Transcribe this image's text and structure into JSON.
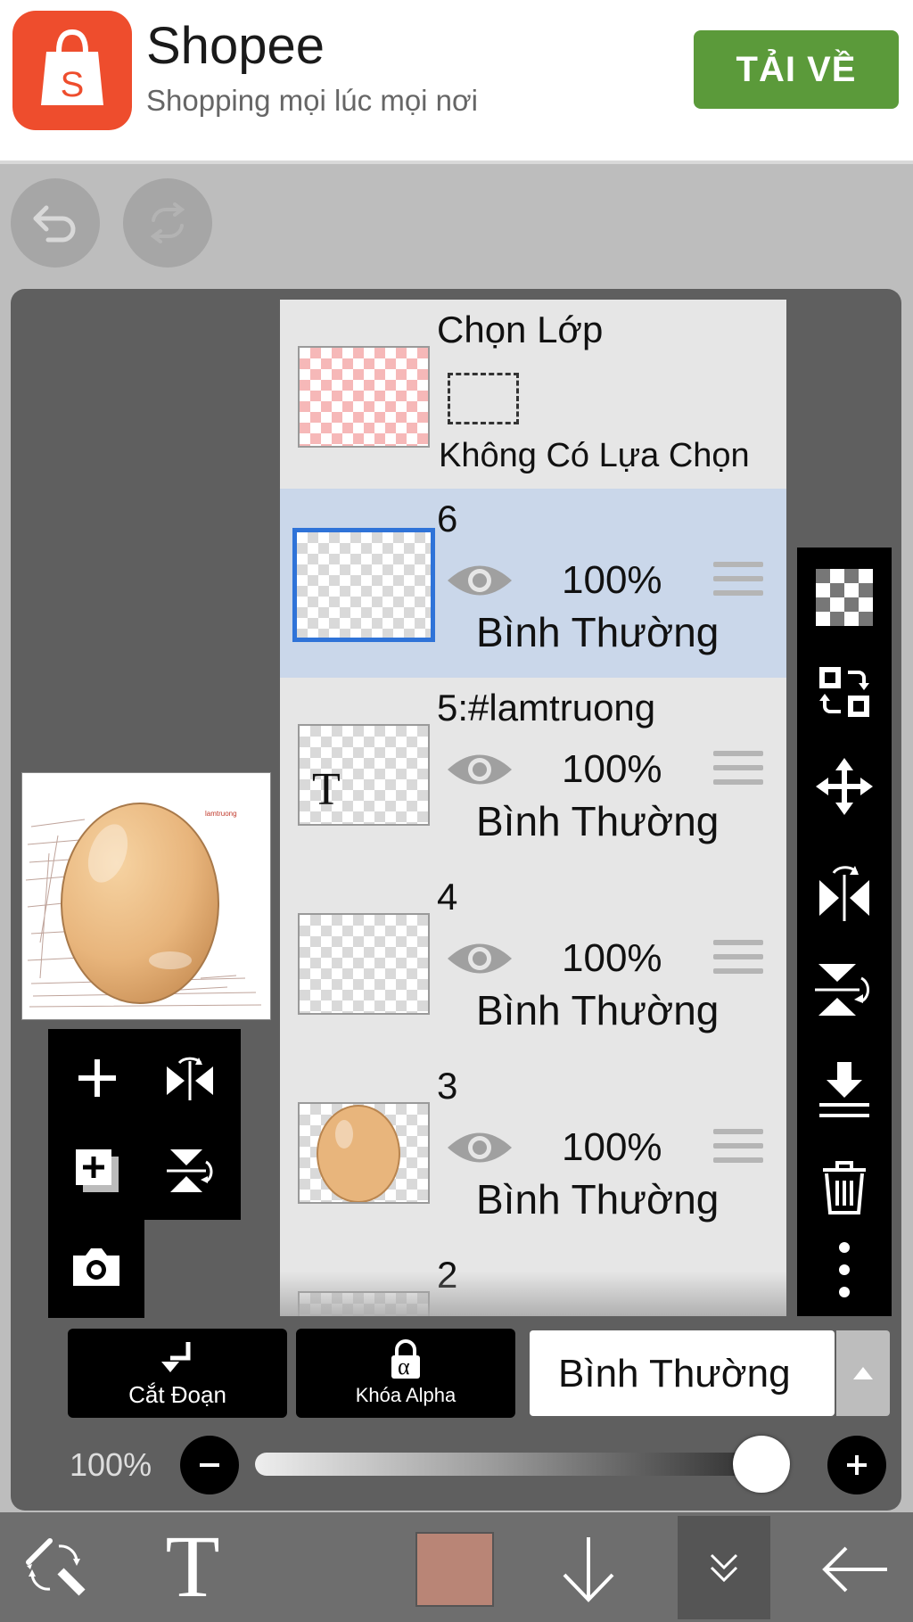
{
  "ad": {
    "app_name": "Shopee",
    "tagline": "Shopping mọi lúc mọi nơi",
    "logo_letter": "S",
    "cta_label": "TẢI VỀ",
    "brand_color": "#ee4d2d",
    "cta_color": "#5b9a3a"
  },
  "top_controls": {
    "undo_icon": "undo-icon",
    "redo_icon": "redo-icon"
  },
  "selection_layer": {
    "title": "Chọn Lớp",
    "status": "Không Có Lựa Chọn"
  },
  "layers": [
    {
      "name": "6",
      "opacity": "100%",
      "blend": "Bình Thường",
      "selected": true
    },
    {
      "name": "5:#lamtruong",
      "opacity": "100%",
      "blend": "Bình Thường",
      "thumb_glyph": "T"
    },
    {
      "name": "4",
      "opacity": "100%",
      "blend": "Bình Thường"
    },
    {
      "name": "3",
      "opacity": "100%",
      "blend": "Bình Thường"
    },
    {
      "name": "2"
    }
  ],
  "preview_caption": "lamtruong",
  "right_tools": [
    "transparency-icon",
    "layer-swap-icon",
    "move-icon",
    "flip-horizontal-icon",
    "flip-vertical-icon",
    "merge-down-icon",
    "trash-icon",
    "more-icon"
  ],
  "left_tools": [
    "add-layer-icon",
    "flip-horizontal-icon",
    "duplicate-layer-icon",
    "flip-vertical-icon",
    "camera-icon"
  ],
  "actions": {
    "clip_label": "Cắt Đoạn",
    "alpha_lock_label": "Khóa Alpha",
    "alpha_symbol": "α",
    "blend_mode": "Bình Thường"
  },
  "opacity": {
    "label": "100%",
    "value_percent": 100
  },
  "bottom_bar": {
    "tools": [
      "brush-eraser-swap-icon",
      "text-tool-icon",
      "color-swatch",
      "download-icon",
      "collapse-icon",
      "back-arrow-icon"
    ],
    "text_glyph": "T",
    "color": "#b98576"
  }
}
